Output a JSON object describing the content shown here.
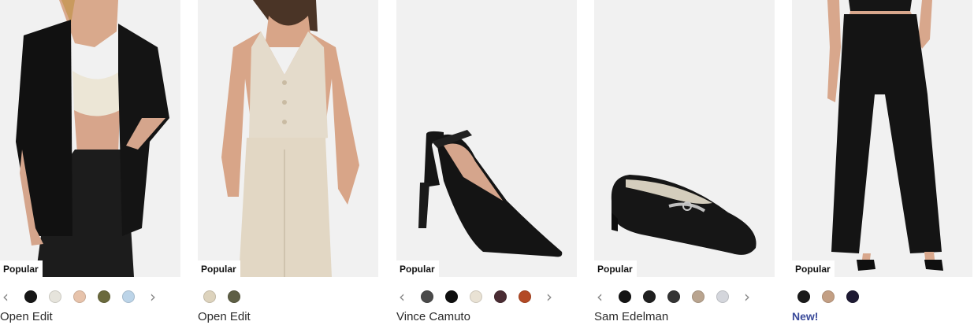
{
  "products": [
    {
      "badge": "Popular",
      "brand": "Open Edit",
      "image": "black-blazer-outfit",
      "has_arrows": true,
      "swatches": [
        "#161616",
        "#e6e4dc",
        "#e7c3ab",
        "#6b6a3d",
        "#bcd4e8"
      ]
    },
    {
      "badge": "Popular",
      "brand": "Open Edit",
      "image": "beige-halter-vest-outfit",
      "has_arrows": false,
      "swatches": [
        "#ddd3bd",
        "#5e5f45"
      ]
    },
    {
      "badge": "Popular",
      "brand": "Vince Camuto",
      "image": "black-slingback-pump",
      "has_arrows": true,
      "swatches": [
        "#4a4a4a",
        "#0e0e0e",
        "#e9e2d4",
        "#4a2c33",
        "#b34a25"
      ]
    },
    {
      "badge": "Popular",
      "brand": "Sam Edelman",
      "image": "black-bit-loafer",
      "has_arrows": true,
      "swatches": [
        "#141414",
        "#1f1f1f",
        "#343434",
        "#b9a48f",
        "#d4d6dc"
      ]
    },
    {
      "badge": "Popular",
      "brand": "New!",
      "brand_is_flag": true,
      "image": "black-wide-leg-pants",
      "has_arrows": false,
      "swatches": [
        "#1a1a1a",
        "#c39f84",
        "#1e1a33"
      ]
    }
  ],
  "icons": {
    "prev": "chevron-left-icon",
    "next": "chevron-right-icon"
  },
  "arrow_glyphs": {
    "prev": "‹",
    "next": "›"
  }
}
